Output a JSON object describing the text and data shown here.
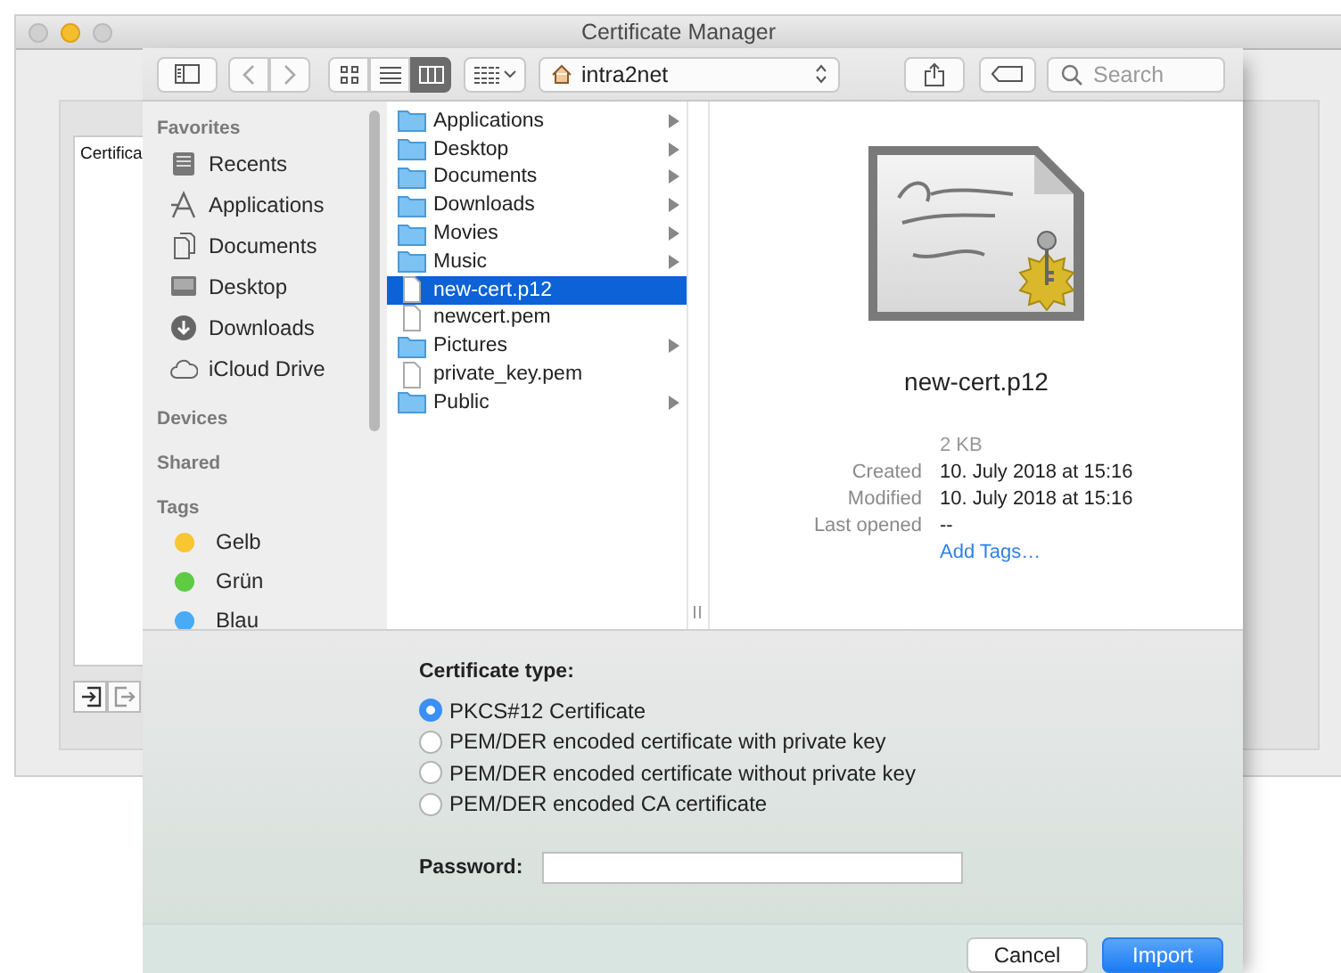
{
  "background_window": {
    "title": "Certificate Manager",
    "list_header": "Certifica"
  },
  "toolbar": {
    "view_modes": [
      {
        "kind": "icons",
        "selected": false
      },
      {
        "kind": "list",
        "selected": false
      },
      {
        "kind": "columns",
        "selected": true
      }
    ],
    "location": "intra2net",
    "search": {
      "placeholder": "Search"
    }
  },
  "sidebar": {
    "favorites": {
      "heading": "Favorites",
      "items": [
        {
          "label": "Recents",
          "kind": "recents"
        },
        {
          "label": "Applications",
          "kind": "applications"
        },
        {
          "label": "Documents",
          "kind": "documents"
        },
        {
          "label": "Desktop",
          "kind": "desktop"
        },
        {
          "label": "Downloads",
          "kind": "downloads"
        },
        {
          "label": "iCloud Drive",
          "kind": "cloud"
        }
      ]
    },
    "headings": [
      "Devices",
      "Shared"
    ],
    "tags": {
      "heading": "Tags",
      "items": [
        {
          "label": "Gelb",
          "color": "#f7c631"
        },
        {
          "label": "Grün",
          "color": "#5fcb45"
        },
        {
          "label": "Blau",
          "color": "#4aaaf5"
        }
      ]
    }
  },
  "files": [
    {
      "name": "Applications",
      "kind": "folder",
      "selected": false
    },
    {
      "name": "Desktop",
      "kind": "folder",
      "selected": false
    },
    {
      "name": "Documents",
      "kind": "folder",
      "selected": false
    },
    {
      "name": "Downloads",
      "kind": "folder",
      "selected": false
    },
    {
      "name": "Movies",
      "kind": "folder",
      "selected": false
    },
    {
      "name": "Music",
      "kind": "folder",
      "selected": false
    },
    {
      "name": "new-cert.p12",
      "kind": "file",
      "selected": true
    },
    {
      "name": "newcert.pem",
      "kind": "file",
      "selected": false
    },
    {
      "name": "Pictures",
      "kind": "folder",
      "selected": false
    },
    {
      "name": "private_key.pem",
      "kind": "file",
      "selected": false
    },
    {
      "name": "Public",
      "kind": "folder",
      "selected": false
    }
  ],
  "preview": {
    "name": "new-cert.p12",
    "size": "2 KB",
    "info": [
      {
        "label": "Created",
        "value": "10. July 2018 at 15:16"
      },
      {
        "label": "Modified",
        "value": "10. July 2018 at 15:16"
      },
      {
        "label": "Last opened",
        "value": "--"
      }
    ],
    "add_tags": "Add Tags…"
  },
  "certificate_type": {
    "label": "Certificate type:",
    "options": [
      {
        "label": "PKCS#12 Certificate",
        "selected": true
      },
      {
        "label": "PEM/DER encoded certificate with private key",
        "selected": false
      },
      {
        "label": "PEM/DER encoded certificate without private key",
        "selected": false
      },
      {
        "label": "PEM/DER encoded CA certificate",
        "selected": false
      }
    ]
  },
  "password": {
    "label": "Password:"
  },
  "buttons": [
    {
      "label": "Cancel",
      "kind": "secondary"
    },
    {
      "label": "Import",
      "kind": "primary"
    }
  ]
}
